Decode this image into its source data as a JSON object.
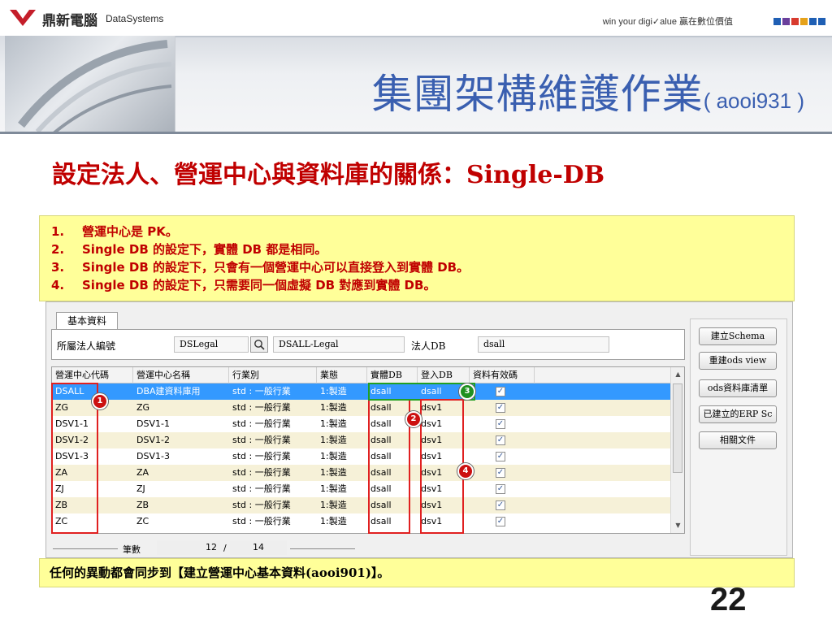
{
  "header": {
    "logo_cn": "鼎新電腦",
    "logo_en": "DataSystems",
    "slogan": "win your digi✓alue 贏在數位價值",
    "brand_colors": [
      "#1f5fb4",
      "#6a3f9c",
      "#d83a2e",
      "#e6a21a",
      "#1f5fb4",
      "#1f5fb4"
    ]
  },
  "banner": {
    "title_cn": "集團架構維護作業",
    "title_code": "( aooi931 )"
  },
  "subtitle": "設定法人、營運中心與資料庫的關係：Single-DB",
  "notes": [
    {
      "num": "1.",
      "text": "營運中心是 PK。"
    },
    {
      "num": "2.",
      "text": "Single DB 的設定下，實體 DB 都是相同。"
    },
    {
      "num": "3.",
      "text": "Single DB 的設定下，只會有一個營運中心可以直接登入到實體 DB。"
    },
    {
      "num": "4.",
      "text": "Single DB 的設定下，只需要同一個虛擬 DB 對應到實體 DB。"
    }
  ],
  "app": {
    "tab_label": "基本資料",
    "form": {
      "legal_label": "所屬法人編號",
      "legal_code": "DSLegal",
      "legal_name": "DSALL-Legal",
      "db_label": "法人DB",
      "db_value": "dsall"
    },
    "grid": {
      "headers": [
        "營運中心代碼",
        "營運中心名稱",
        "行業別",
        "業態",
        "實體DB",
        "登入DB",
        "資料有效碼"
      ],
      "rows": [
        {
          "code": "DSALL",
          "name": "DBA建資料庫用",
          "industry": "std : 一般行業",
          "type": "1:製造",
          "phys_db": "dsall",
          "login_db": "dsall",
          "valid": "✓"
        },
        {
          "code": "ZG",
          "name": "ZG",
          "industry": "std : 一般行業",
          "type": "1:製造",
          "phys_db": "dsall",
          "login_db": "dsv1",
          "valid": "✓"
        },
        {
          "code": "DSV1-1",
          "name": "DSV1-1",
          "industry": "std : 一般行業",
          "type": "1:製造",
          "phys_db": "dsall",
          "login_db": "dsv1",
          "valid": "✓"
        },
        {
          "code": "DSV1-2",
          "name": "DSV1-2",
          "industry": "std : 一般行業",
          "type": "1:製造",
          "phys_db": "dsall",
          "login_db": "dsv1",
          "valid": "✓"
        },
        {
          "code": "DSV1-3",
          "name": "DSV1-3",
          "industry": "std : 一般行業",
          "type": "1:製造",
          "phys_db": "dsall",
          "login_db": "dsv1",
          "valid": "✓"
        },
        {
          "code": "ZA",
          "name": "ZA",
          "industry": "std : 一般行業",
          "type": "1:製造",
          "phys_db": "dsall",
          "login_db": "dsv1",
          "valid": "✓"
        },
        {
          "code": "ZJ",
          "name": "ZJ",
          "industry": "std : 一般行業",
          "type": "1:製造",
          "phys_db": "dsall",
          "login_db": "dsv1",
          "valid": "✓"
        },
        {
          "code": "ZB",
          "name": "ZB",
          "industry": "std : 一般行業",
          "type": "1:製造",
          "phys_db": "dsall",
          "login_db": "dsv1",
          "valid": "✓"
        },
        {
          "code": "ZC",
          "name": "ZC",
          "industry": "std : 一般行業",
          "type": "1:製造",
          "phys_db": "dsall",
          "login_db": "dsv1",
          "valid": "✓"
        }
      ]
    },
    "counter": {
      "label": "筆數",
      "current": "12",
      "separator": "/",
      "total": "14"
    },
    "buttons": [
      "建立Schema",
      "重建ods view",
      "ods資料庫清單",
      "已建立的ERP Sc",
      "相關文件"
    ]
  },
  "annotations": [
    "1",
    "2",
    "3",
    "4"
  ],
  "sync_note": "任何的異動都會同步到【建立營運中心基本資料(aooi901)】。",
  "page_number": "22"
}
